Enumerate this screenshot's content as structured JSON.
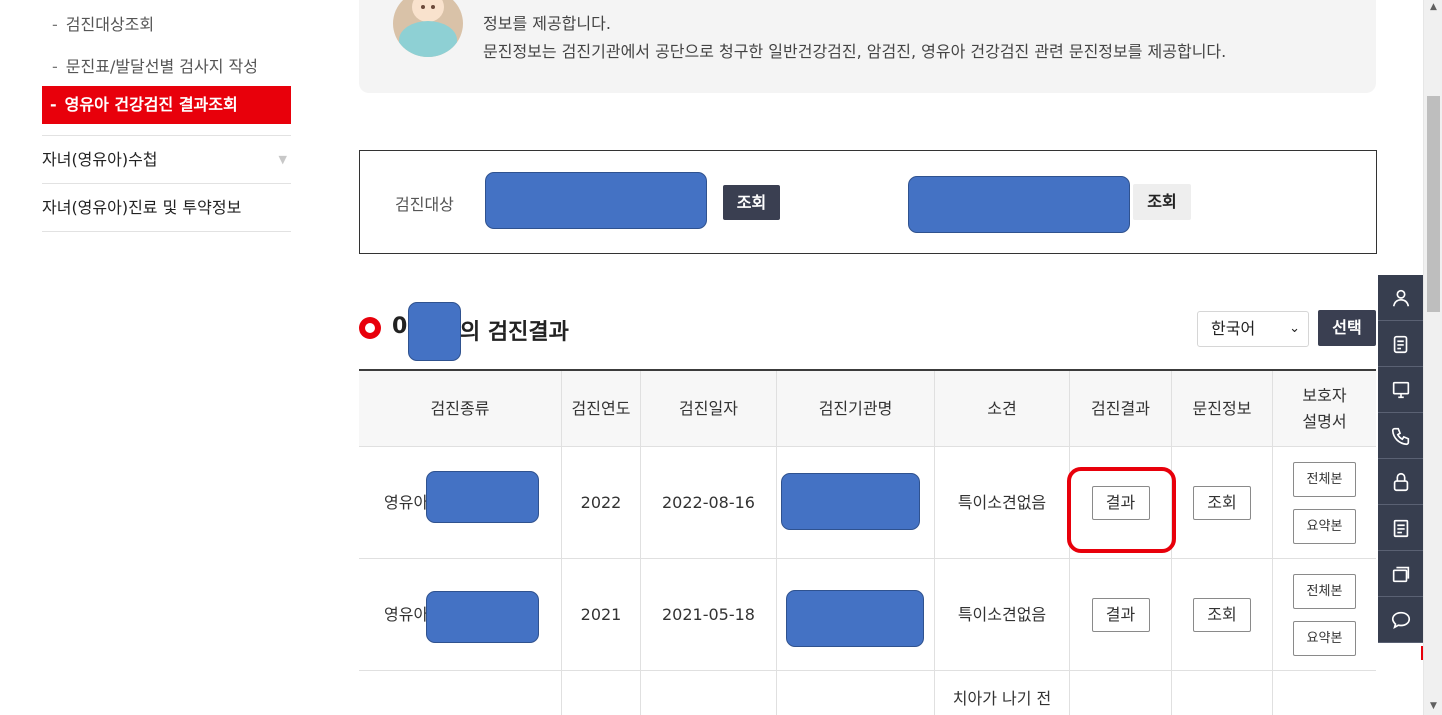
{
  "sidebar": {
    "sub_items": [
      {
        "dash": "-",
        "label": "검진대상조회"
      },
      {
        "dash": "-",
        "label": "문진표/발달선별 검사지 작성"
      },
      {
        "dash": "-",
        "label": "영유아 건강검진 결과조회"
      }
    ],
    "menu_items": [
      {
        "label": "자녀(영유아)수첩",
        "icon": "triangle-down-icon"
      },
      {
        "label": "자녀(영유아)진료 및 투약정보"
      }
    ]
  },
  "info": {
    "line1": "정보를 제공합니다.",
    "line2": "문진정보는 검진기관에서 공단으로 청구한 일반건강검진, 암검진, 영유아 건강검진 관련 문진정보를 제공합니다."
  },
  "search": {
    "label": "검진대상",
    "button1": "조회",
    "button2": "조회"
  },
  "results": {
    "title_prefix": "0",
    "title_suffix": "의 검진결과",
    "language": "한국어",
    "select_button": "선택",
    "columns": [
      "검진종류",
      "검진연도",
      "검진일자",
      "검진기관명",
      "소견",
      "검진결과",
      "문진정보",
      "보호자\n설명서"
    ],
    "rows": [
      {
        "type_prefix": "영유아",
        "year": "2022",
        "date": "2022-08-16",
        "opinion": "특이소견없음",
        "result_button": "결과",
        "questionnaire_button": "조회",
        "guide_full": "전체본",
        "guide_summary": "요약본"
      },
      {
        "type_prefix": "영유아",
        "year": "2021",
        "date": "2021-05-18",
        "opinion": "특이소견없음",
        "result_button": "결과",
        "questionnaire_button": "조회",
        "guide_full": "전체본",
        "guide_summary": "요약본"
      }
    ],
    "partial_row": {
      "opinion": "치아가 나기 전"
    }
  },
  "quick_menu": [
    "person-icon",
    "document-icon",
    "monitor-icon",
    "phone-icon",
    "lock-icon",
    "list-icon",
    "stack-icon",
    "chat-icon"
  ],
  "colors": {
    "accent": "#e8000b",
    "dark_button": "#3a3f51",
    "redaction": "#4472c4"
  }
}
